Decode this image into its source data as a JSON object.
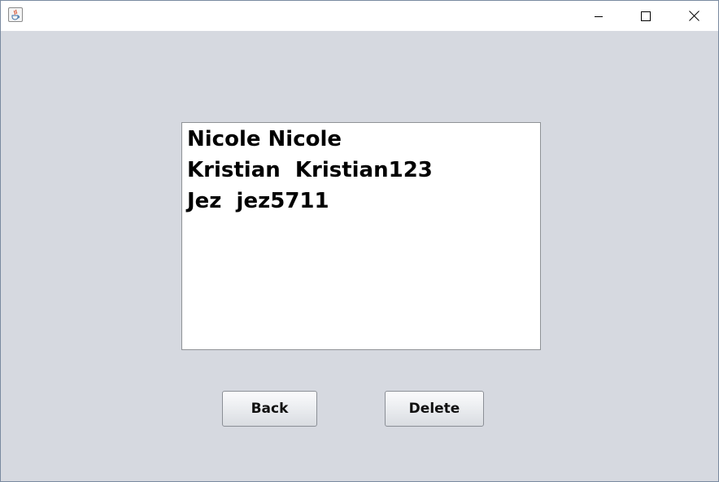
{
  "window": {
    "icons": {
      "app": "java-app-icon",
      "minimize": "minimize-icon",
      "maximize": "maximize-icon",
      "close": "close-icon"
    }
  },
  "user_list": {
    "items": [
      "Nicole Nicole",
      "Kristian  Kristian123",
      "Jez  jez5711"
    ]
  },
  "buttons": {
    "back_label": "Back",
    "delete_label": "Delete"
  },
  "colors": {
    "window_background": "#d6d9e0",
    "titlebar_background": "#ffffff",
    "list_background": "#ffffff",
    "text": "#000000"
  }
}
